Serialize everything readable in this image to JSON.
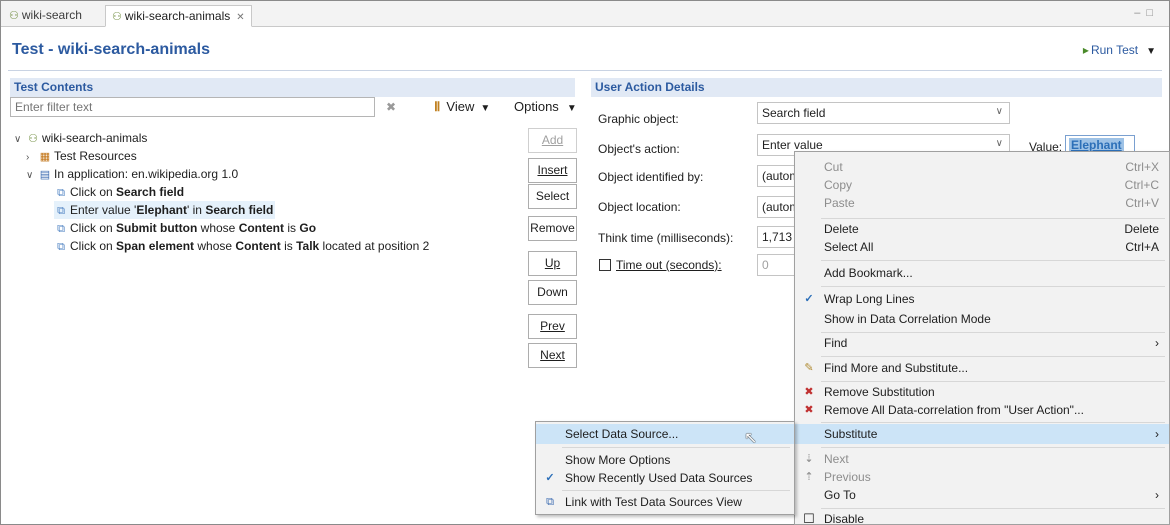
{
  "tabs": [
    {
      "label": "wiki-search",
      "icon": "test-icon"
    },
    {
      "label": "wiki-search-animals",
      "icon": "test-icon",
      "close": "✕"
    }
  ],
  "editor": {
    "title": "Test - wiki-search-animals",
    "run_label": "Run Test"
  },
  "contents": {
    "header": "Test Contents",
    "filter_placeholder": "Enter filter text",
    "view_label": "View",
    "options_label": "Options",
    "tree": [
      {
        "text": "wiki-search-animals",
        "icon": "test-icon",
        "twisty": "open",
        "indent": 0
      },
      {
        "text": "Test Resources",
        "icon": "resources-icon",
        "twisty": "closed",
        "indent": 1
      },
      {
        "text": "In application: en.wikipedia.org  1.0",
        "icon": "application-icon",
        "twisty": "open",
        "indent": 1
      },
      {
        "parts": [
          [
            "Click on ",
            false
          ],
          [
            "Search field",
            true
          ]
        ],
        "icon": "action-icon",
        "indent": 2
      },
      {
        "parts": [
          [
            "Enter value '",
            false
          ],
          [
            "Elephant",
            true
          ],
          [
            "' in ",
            false
          ],
          [
            "Search field",
            true
          ]
        ],
        "icon": "action-icon",
        "indent": 2,
        "selected": true
      },
      {
        "parts": [
          [
            "Click on ",
            false
          ],
          [
            "Submit button",
            true
          ],
          [
            " whose ",
            false
          ],
          [
            "Content",
            true
          ],
          [
            " is ",
            false
          ],
          [
            "Go",
            true
          ]
        ],
        "icon": "action-icon",
        "indent": 2
      },
      {
        "parts": [
          [
            "Click on ",
            false
          ],
          [
            "Span element",
            true
          ],
          [
            " whose ",
            false
          ],
          [
            "Content",
            true
          ],
          [
            " is ",
            false
          ],
          [
            "Talk",
            true
          ],
          [
            " located at position 2",
            false
          ]
        ],
        "icon": "action-icon",
        "indent": 2
      }
    ],
    "buttons": {
      "add": "Add",
      "insert": "Insert",
      "select": "Select",
      "remove": "Remove",
      "up": "Up",
      "down": "Down",
      "prev": "Prev",
      "next": "Next"
    }
  },
  "details": {
    "header": "User Action Details",
    "graphic_object_label": "Graphic object:",
    "graphic_object_value": "Search field",
    "action_label": "Object's action:",
    "action_value": "Enter value",
    "value_label": "Value:",
    "value_value": "Elephant",
    "identified_label": "Object identified by:",
    "identified_value": "(autom",
    "location_label": "Object location:",
    "location_value": "(autom",
    "think_label": "Think time (milliseconds):",
    "think_value": "1,713",
    "timeout_label": "Time out (seconds):",
    "timeout_value": "0"
  },
  "context_menu": {
    "cut": "Cut",
    "cut_key": "Ctrl+X",
    "copy": "Copy",
    "copy_key": "Ctrl+C",
    "paste": "Paste",
    "paste_key": "Ctrl+V",
    "delete": "Delete",
    "delete_key": "Delete",
    "select_all": "Select All",
    "select_all_key": "Ctrl+A",
    "add_bookmark": "Add Bookmark...",
    "wrap": "Wrap Long Lines",
    "show_correlation": "Show in Data Correlation Mode",
    "find": "Find",
    "find_more": "Find More and Substitute...",
    "remove_sub": "Remove Substitution",
    "remove_all": "Remove All Data-correlation from \"User Action\"...",
    "substitute": "Substitute",
    "next": "Next",
    "previous": "Previous",
    "go_to": "Go To",
    "disable": "Disable"
  },
  "submenu": {
    "select_ds": "Select Data Source...",
    "show_more": "Show More Options",
    "show_recent": "Show Recently Used Data Sources",
    "link": "Link with Test Data Sources View"
  },
  "colors": {
    "accent": "#2c5aa0",
    "highlight": "#cce4f7",
    "section_bg": "#e1e9f5"
  }
}
